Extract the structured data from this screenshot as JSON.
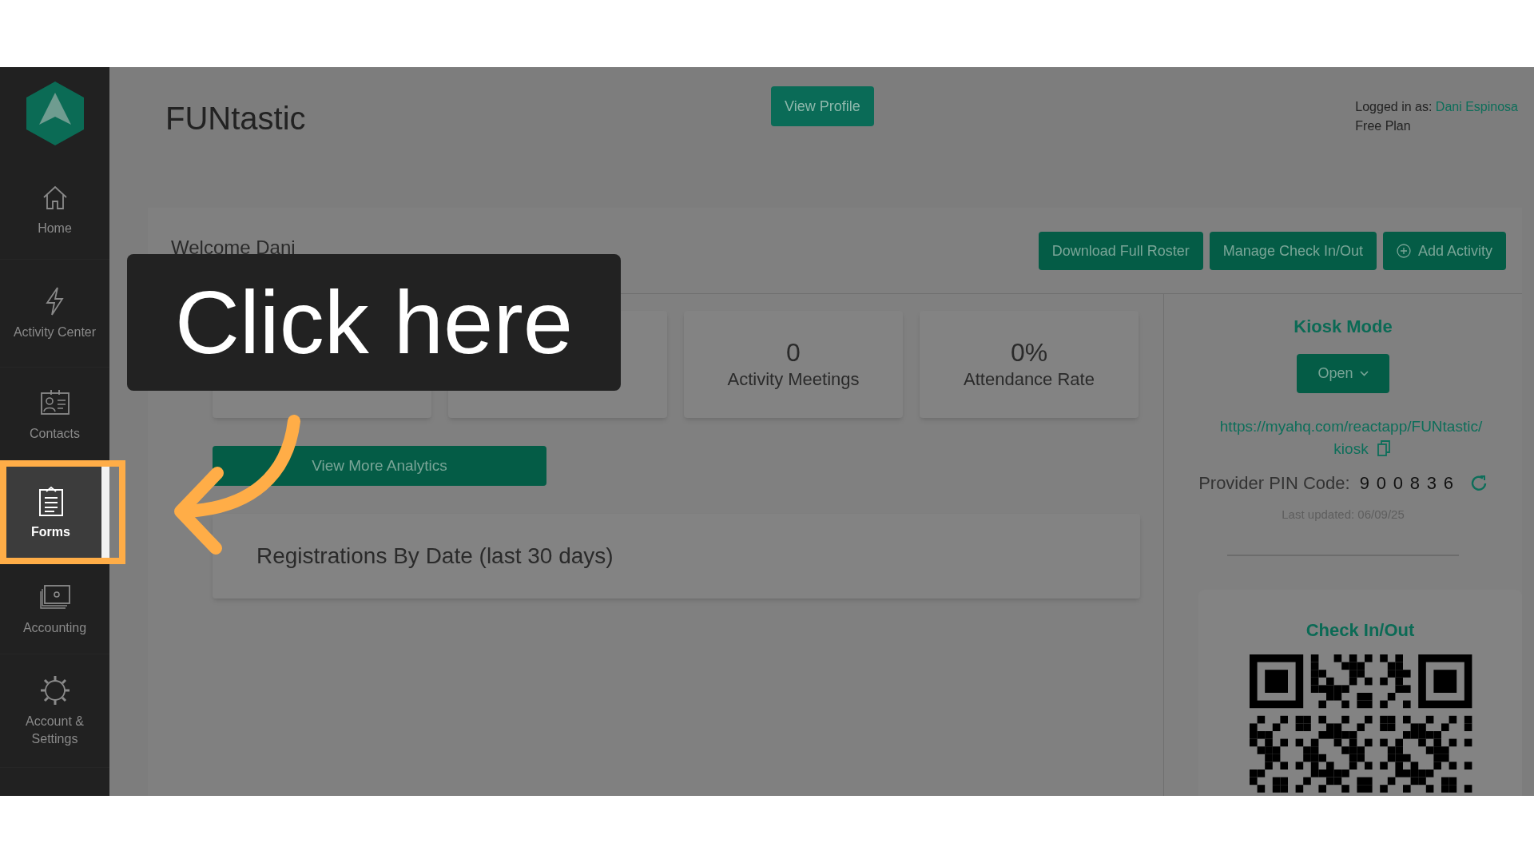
{
  "sidebar": {
    "items": [
      {
        "label": "Home",
        "selected": false
      },
      {
        "label": "Activity Center",
        "selected": false
      },
      {
        "label": "Contacts",
        "selected": false
      },
      {
        "label": "Forms",
        "selected": true
      },
      {
        "label": "Accounting",
        "selected": false
      },
      {
        "label": "Account & Settings",
        "selected": false
      }
    ]
  },
  "header": {
    "title": "FUNtastic",
    "profile_button": "View Profile",
    "logged_in_label": "Logged in as:",
    "user_name": "Dani Espinosa",
    "plan": "Free Plan"
  },
  "welcome": "Welcome Dani",
  "actions": [
    {
      "label": "Download Full Roster",
      "kind": "plain"
    },
    {
      "label": "Manage Check In/Out",
      "kind": "plain"
    },
    {
      "label": "Add Activity",
      "kind": "add"
    }
  ],
  "stats": [
    {
      "value": "0",
      "label": "Activity Meetings"
    },
    {
      "value": "0%",
      "label": "Attendance Rate"
    }
  ],
  "analytics_button": "View More Analytics",
  "registrations_card": {
    "title": "Registrations By Date (last 30 days)"
  },
  "kiosk": {
    "title": "Kiosk Mode",
    "open_button": "Open",
    "url": "https://myahq.com/reactapp/FUNtastic/kiosk",
    "pin_label": "Provider PIN Code:",
    "pin": "900836",
    "last_updated": "Last updated: 06/09/25"
  },
  "checkin": {
    "title": "Check In/Out"
  },
  "callout": {
    "text": "Click here"
  }
}
